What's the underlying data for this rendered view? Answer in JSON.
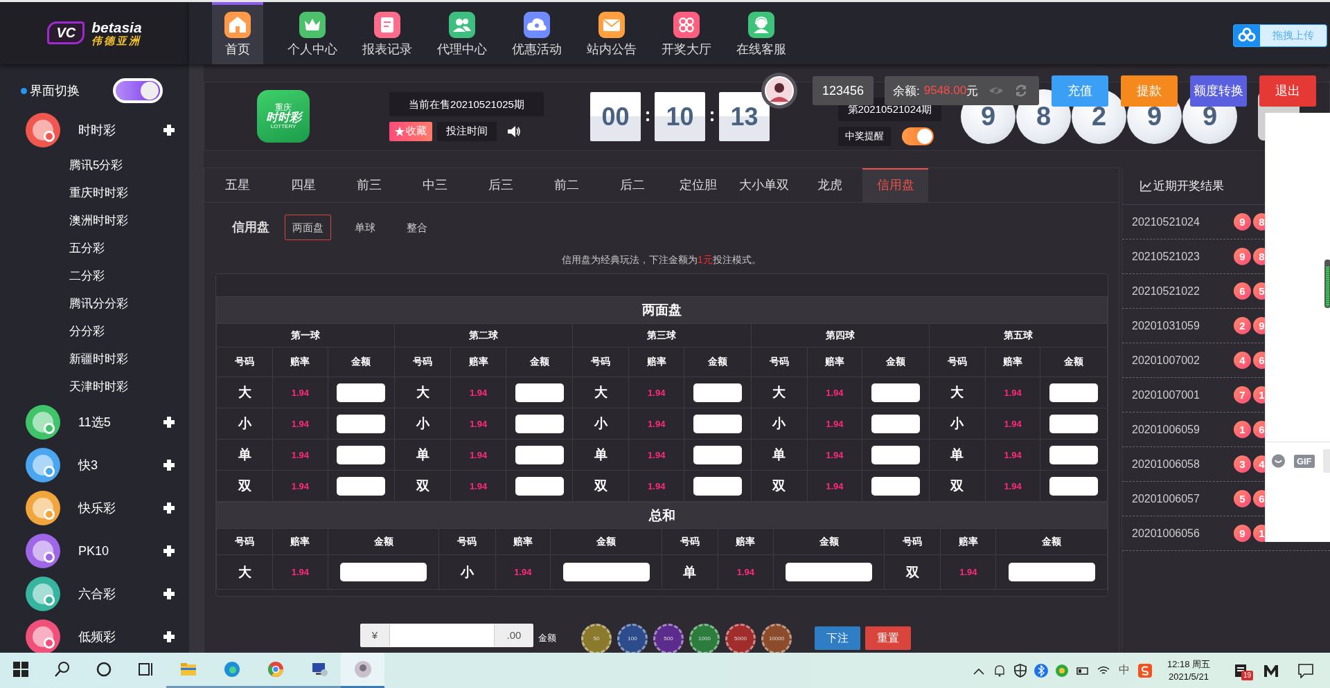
{
  "logo": {
    "mark": "VC",
    "brand": "betasia",
    "subtitle": "伟德亚洲"
  },
  "nav": [
    {
      "label": "首页",
      "selected": true,
      "color": "#ff9a4a"
    },
    {
      "label": "个人中心",
      "selected": false,
      "color": "#4cc06a"
    },
    {
      "label": "报表记录",
      "selected": false,
      "color": "#ff6b8a"
    },
    {
      "label": "代理中心",
      "selected": false,
      "color": "#3fbf7f"
    },
    {
      "label": "优惠活动",
      "selected": false,
      "color": "#6f8bff"
    },
    {
      "label": "站内公告",
      "selected": false,
      "color": "#ffa040"
    },
    {
      "label": "开奖大厅",
      "selected": false,
      "color": "#ff5e7e"
    },
    {
      "label": "在线客服",
      "selected": false,
      "color": "#3ec37a"
    }
  ],
  "upload_button": "拖拽上传",
  "sidebar": {
    "switch": {
      "label": "界面切换",
      "on": true
    },
    "categories": [
      {
        "label": "时时彩",
        "color": "#f2574f",
        "children": [
          "腾讯5分彩",
          "重庆时时彩",
          "澳洲时时彩",
          "五分彩",
          "二分彩",
          "腾讯分分彩",
          "分分彩",
          "新疆时时彩",
          "天津时时彩"
        ]
      },
      {
        "label": "11选5",
        "color": "#3fc46a"
      },
      {
        "label": "快3",
        "color": "#4aa6f0"
      },
      {
        "label": "快乐彩",
        "color": "#f2a53a"
      },
      {
        "label": "PK10",
        "color": "#a066e8"
      },
      {
        "label": "六合彩",
        "color": "#36b6a0"
      },
      {
        "label": "低频彩",
        "color": "#f0507a"
      }
    ]
  },
  "lottery": {
    "logo_lines": [
      "重庆",
      "时时彩",
      "LOTTERY"
    ],
    "current_period": "当前在售20210521025期",
    "favorite": "收藏",
    "bet_time": "投注时间",
    "countdown": [
      "00",
      "10",
      "13"
    ],
    "last_period": "第20210521024期",
    "win_alert": {
      "label": "中奖提醒",
      "on": true
    },
    "balls": [
      "9",
      "8",
      "2",
      "9",
      "9"
    ]
  },
  "user": {
    "id": "123456",
    "balance_label": "余额:",
    "balance": "9548.00",
    "currency": "元",
    "buttons": [
      {
        "label": "充值",
        "color": "#3a9ff5"
      },
      {
        "label": "提款",
        "color": "#f5891e"
      },
      {
        "label": "额度转换",
        "color": "#5a5fe0"
      },
      {
        "label": "退出",
        "color": "#e53935"
      }
    ]
  },
  "play_tabs": [
    {
      "label": "五星",
      "selected": false
    },
    {
      "label": "四星",
      "selected": false
    },
    {
      "label": "前三",
      "selected": false
    },
    {
      "label": "中三",
      "selected": false
    },
    {
      "label": "后三",
      "selected": false
    },
    {
      "label": "前二",
      "selected": false
    },
    {
      "label": "后二",
      "selected": false
    },
    {
      "label": "定位胆",
      "selected": false
    },
    {
      "label": "大小单双",
      "selected": false
    },
    {
      "label": "龙虎",
      "selected": false
    },
    {
      "label": "信用盘",
      "selected": true
    }
  ],
  "sub_tabs": {
    "title": "信用盘",
    "options": [
      {
        "label": "两面盘",
        "selected": true
      },
      {
        "label": "单球",
        "selected": false
      },
      {
        "label": "整合",
        "selected": false
      }
    ]
  },
  "notice": {
    "before": "信用盘为经典玩法，下注金额为",
    "highlight": "1元",
    "after": "投注模式。"
  },
  "two_sides": {
    "title": "两面盘",
    "balls": [
      {
        "name": "第一球",
        "headers": [
          "号码",
          "赔率",
          "金额"
        ],
        "rows": [
          {
            "number": "大",
            "odds": "1.94"
          },
          {
            "number": "小",
            "odds": "1.94"
          },
          {
            "number": "单",
            "odds": "1.94"
          },
          {
            "number": "双",
            "odds": "1.94"
          }
        ]
      },
      {
        "name": "第二球",
        "headers": [
          "号码",
          "赔率",
          "金额"
        ],
        "rows": [
          {
            "number": "大",
            "odds": "1.94"
          },
          {
            "number": "小",
            "odds": "1.94"
          },
          {
            "number": "单",
            "odds": "1.94"
          },
          {
            "number": "双",
            "odds": "1.94"
          }
        ]
      },
      {
        "name": "第三球",
        "headers": [
          "号码",
          "赔率",
          "金额"
        ],
        "rows": [
          {
            "number": "大",
            "odds": "1.94"
          },
          {
            "number": "小",
            "odds": "1.94"
          },
          {
            "number": "单",
            "odds": "1.94"
          },
          {
            "number": "双",
            "odds": "1.94"
          }
        ]
      },
      {
        "name": "第四球",
        "headers": [
          "号码",
          "赔率",
          "金额"
        ],
        "rows": [
          {
            "number": "大",
            "odds": "1.94"
          },
          {
            "number": "小",
            "odds": "1.94"
          },
          {
            "number": "单",
            "odds": "1.94"
          },
          {
            "number": "双",
            "odds": "1.94"
          }
        ]
      },
      {
        "name": "第五球",
        "headers": [
          "号码",
          "赔率",
          "金额"
        ],
        "rows": [
          {
            "number": "大",
            "odds": "1.94"
          },
          {
            "number": "小",
            "odds": "1.94"
          },
          {
            "number": "单",
            "odds": "1.94"
          },
          {
            "number": "双",
            "odds": "1.94"
          }
        ]
      }
    ]
  },
  "sum": {
    "title": "总和",
    "items": [
      {
        "headers": [
          "号码",
          "赔率",
          "金额"
        ],
        "number": "大",
        "odds": "1.94"
      },
      {
        "headers": [
          "号码",
          "赔率",
          "金额"
        ],
        "number": "小",
        "odds": "1.94"
      },
      {
        "headers": [
          "号码",
          "赔率",
          "金额"
        ],
        "number": "单",
        "odds": "1.94"
      },
      {
        "headers": [
          "号码",
          "赔率",
          "金额"
        ],
        "number": "双",
        "odds": "1.94"
      }
    ]
  },
  "bet_bar": {
    "currency": "¥",
    "decimals": ".00",
    "amount_label": "金额",
    "chips": [
      {
        "label": "50",
        "color": "#8c7a2c"
      },
      {
        "label": "100",
        "color": "#2c4c8c"
      },
      {
        "label": "500",
        "color": "#5c2c8c"
      },
      {
        "label": "1000",
        "color": "#2c7c3c"
      },
      {
        "label": "5000",
        "color": "#a02c2c"
      },
      {
        "label": "10000",
        "color": "#8c4c2c"
      }
    ],
    "submit": "下注",
    "reset": "重置"
  },
  "results": {
    "title": "近期开奖结果",
    "rows": [
      {
        "period": "20210521024",
        "balls": [
          "9",
          "8"
        ]
      },
      {
        "period": "20210521023",
        "balls": [
          "9",
          "8"
        ]
      },
      {
        "period": "20210521022",
        "balls": [
          "6",
          "5"
        ]
      },
      {
        "period": "20201031059",
        "balls": [
          "2",
          "9"
        ]
      },
      {
        "period": "20201007002",
        "balls": [
          "4",
          "6"
        ]
      },
      {
        "period": "20201007001",
        "balls": [
          "7",
          "1"
        ]
      },
      {
        "period": "20201006059",
        "balls": [
          "1",
          "6"
        ]
      },
      {
        "period": "20201006058",
        "balls": [
          "3",
          "4"
        ]
      },
      {
        "period": "20201006057",
        "balls": [
          "5",
          "6"
        ]
      },
      {
        "period": "20201006056",
        "balls": [
          "9",
          "1"
        ]
      }
    ]
  },
  "chat_widget": {
    "gif": "GIF"
  },
  "taskbar": {
    "apps": [
      {
        "selected": false
      },
      {
        "selected": false
      },
      {
        "selected": false
      },
      {
        "selected": false
      },
      {
        "selected": true
      }
    ],
    "ime": "中",
    "time": "12:18 周五",
    "date": "2021/5/21",
    "notifications": "19"
  }
}
